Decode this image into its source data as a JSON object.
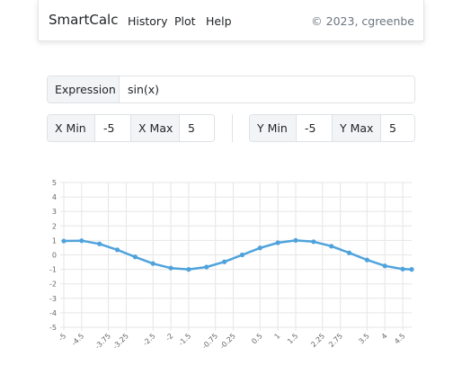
{
  "navbar": {
    "brand": "SmartCalc",
    "links": [
      "History",
      "Plot",
      "Help"
    ],
    "copyright": "© 2023, cgreenbe"
  },
  "expression": {
    "label": "Expression",
    "value": "sin(x)"
  },
  "x_range": {
    "min_label": "X Min",
    "min_value": "-5",
    "max_label": "X Max",
    "max_value": "5"
  },
  "y_range": {
    "min_label": "Y Min",
    "min_value": "-5",
    "max_label": "Y Max",
    "max_value": "5"
  },
  "colors": {
    "line": "#4fa3dc",
    "grid": "#e6e6e6",
    "axis": "#cccccc"
  },
  "chart_data": {
    "type": "line",
    "title": "",
    "xlabel": "",
    "ylabel": "",
    "grid": true,
    "xlim": [
      -5,
      4.75
    ],
    "ylim": [
      -5,
      5
    ],
    "x_ticks": [
      "-5",
      "-4.5",
      "-3.75",
      "-3.25",
      "-2.5",
      "-2",
      "-1.5",
      "-0.75",
      "-0.25",
      "0.5",
      "1",
      "1.5",
      "2.25",
      "2.75",
      "3.5",
      "4",
      "4.5"
    ],
    "y_ticks": [
      "5",
      "4",
      "3",
      "2",
      "1",
      "0",
      "-1",
      "-2",
      "-3",
      "-4",
      "-5"
    ],
    "series": [
      {
        "x": [
          -5,
          -4.5,
          -4,
          -3.5,
          -3,
          -2.5,
          -2,
          -1.5,
          -1,
          -0.5,
          0,
          0.5,
          1,
          1.5,
          2,
          2.5,
          3,
          3.5,
          4,
          4.5,
          4.75
        ],
        "y": [
          0.96,
          0.98,
          0.76,
          0.35,
          -0.14,
          -0.6,
          -0.91,
          -1.0,
          -0.84,
          -0.48,
          0.0,
          0.48,
          0.84,
          1.0,
          0.91,
          0.6,
          0.14,
          -0.35,
          -0.76,
          -0.98,
          -1.0
        ]
      }
    ]
  }
}
